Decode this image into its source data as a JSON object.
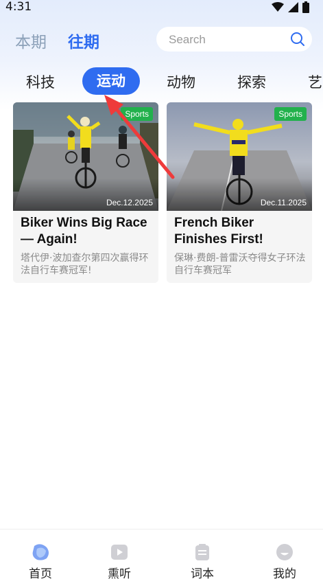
{
  "status": {
    "time": "4:31"
  },
  "header": {
    "tabs": [
      {
        "label": "本期",
        "active": false
      },
      {
        "label": "往期",
        "active": true
      }
    ],
    "search": {
      "placeholder": "Search"
    }
  },
  "categories": [
    {
      "label": "科技",
      "active": false
    },
    {
      "label": "运动",
      "active": true
    },
    {
      "label": "动物",
      "active": false
    },
    {
      "label": "探索",
      "active": false
    },
    {
      "label": "艺",
      "active": false
    }
  ],
  "cards": [
    {
      "badge": "Sports",
      "date": "Dec.12.2025",
      "title": "Biker Wins Big Race — Again!",
      "subtitle": "塔代伊·波加查尔第四次赢得环法自行车赛冠军!"
    },
    {
      "badge": "Sports",
      "date": "Dec.11.2025",
      "title": "French Biker Finishes First!",
      "subtitle": "保琳·费朗-普雷沃夺得女子环法自行车赛冠军"
    }
  ],
  "bottom_nav": [
    {
      "label": "首页",
      "icon": "home-icon",
      "active": true
    },
    {
      "label": "熏听",
      "icon": "play-icon",
      "active": false
    },
    {
      "label": "词本",
      "icon": "notebook-icon",
      "active": false
    },
    {
      "label": "我的",
      "icon": "profile-icon",
      "active": false
    }
  ],
  "colors": {
    "accent": "#2f6cf0",
    "badge": "#22b14c",
    "annotation_arrow": "#ee3b3b",
    "jersey": "#f2dd1d"
  }
}
